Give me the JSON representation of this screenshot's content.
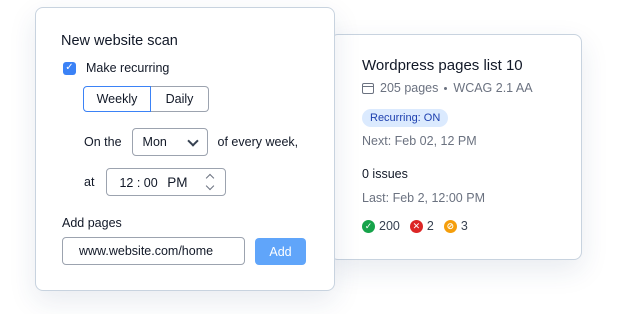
{
  "scan_form": {
    "title": "New website scan",
    "recurring_label": "Make recurring",
    "recurring_checked": true,
    "frequency_tabs": [
      "Weekly",
      "Daily"
    ],
    "frequency_selected": "Weekly",
    "on_the_label": "On the",
    "day_value": "Mon",
    "every_week_label": "of every week,",
    "at_label": "at",
    "time_hour": "12",
    "time_sep": ":",
    "time_min": "00",
    "time_ampm": "PM",
    "add_pages_label": "Add pages",
    "url_value": "www.website.com/home",
    "add_button": "Add"
  },
  "scan_card": {
    "title": "Wordpress pages list 10",
    "pages": "205 pages",
    "standard": "WCAG 2.1 AA",
    "recurring_badge": "Recurring: ON",
    "next": "Next: Feb 02, 12 PM",
    "issues": "0 issues",
    "last": "Last: Feb 2, 12:00 PM",
    "stats": {
      "passed": "200",
      "failed": "2",
      "warnings": "3"
    },
    "colors": {
      "passed": "#16a34a",
      "failed": "#dc2626",
      "warnings": "#f59e0b",
      "accent": "#3b82f6"
    }
  }
}
